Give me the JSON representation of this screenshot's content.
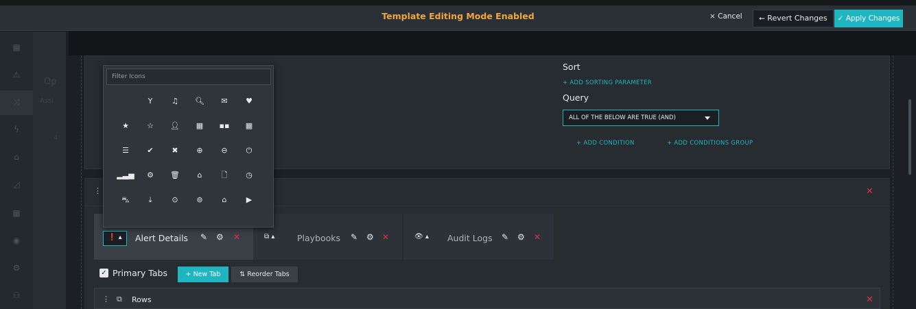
{
  "topbar": {
    "title": "Template Editing Mode Enabled",
    "cancel_label": "× Cancel",
    "revert_label": "⭠ Revert Changes",
    "apply_label": "✓ Apply Changes"
  },
  "behind": {
    "op_text": "Op",
    "assign_text": "Assi",
    "num_text": "4"
  },
  "filters": {
    "sort_label": "Sort",
    "add_sort": "+ ADD SORTING PARAMETER",
    "query_label": "Query",
    "query_value": "ALL OF THE BELOW ARE TRUE (AND)",
    "add_condition": "+ ADD CONDITION",
    "add_group": "+ ADD CONDITIONS GROUP"
  },
  "picker": {
    "placeholder": "Filter Icons",
    "rows": [
      [
        "",
        "glass-icon",
        "music-icon",
        "search-icon",
        "envelope-icon",
        "heart-icon"
      ],
      [
        "star-icon",
        "star-outline-icon",
        "user-icon",
        "film-icon",
        "th-large-icon",
        "th-icon"
      ],
      [
        "th-list-icon",
        "check-icon",
        "close-icon",
        "zoom-in-icon",
        "zoom-out-icon",
        "power-off-icon"
      ],
      [
        "signal-icon",
        "cog-icon",
        "trash-icon",
        "home-icon",
        "file-icon",
        "clock-icon"
      ],
      [
        "road-icon",
        "download-icon",
        "arrow-circle-down-icon",
        "arrow-circle-up-icon",
        "inbox-icon",
        "play-circle-icon"
      ]
    ],
    "glyphs": [
      [
        "",
        "Y",
        "♫",
        "🔍︎",
        "✉",
        "♥"
      ],
      [
        "★",
        "☆",
        "👤︎",
        "▦",
        "▪▪",
        "▦"
      ],
      [
        "☰",
        "✔",
        "✖",
        "⊕",
        "⊖",
        "⏻"
      ],
      [
        "▂▃▅",
        "⚙",
        "🗑︎",
        "⌂",
        "🗋",
        "◷"
      ],
      [
        "⛍",
        "⤓",
        "⊙",
        "⊚",
        "⌂",
        "▶"
      ]
    ]
  },
  "tabs": [
    {
      "icon": "exclamation-circle-icon",
      "glyph": "❗",
      "label": "Alert Details"
    },
    {
      "icon": "sitemap-icon",
      "glyph": "⧉",
      "label": "Playbooks"
    },
    {
      "icon": "eye-icon",
      "glyph": "👁︎",
      "label": "Audit Logs"
    }
  ],
  "primary": {
    "checkbox_label": "Primary Tabs",
    "new_tab": "+ New Tab",
    "reorder": "⇅ Reorder Tabs"
  },
  "rows": {
    "label": "Rows"
  },
  "colors": {
    "accent": "#1fb6c1",
    "warning": "#f0a63a",
    "danger": "#e0304a"
  }
}
